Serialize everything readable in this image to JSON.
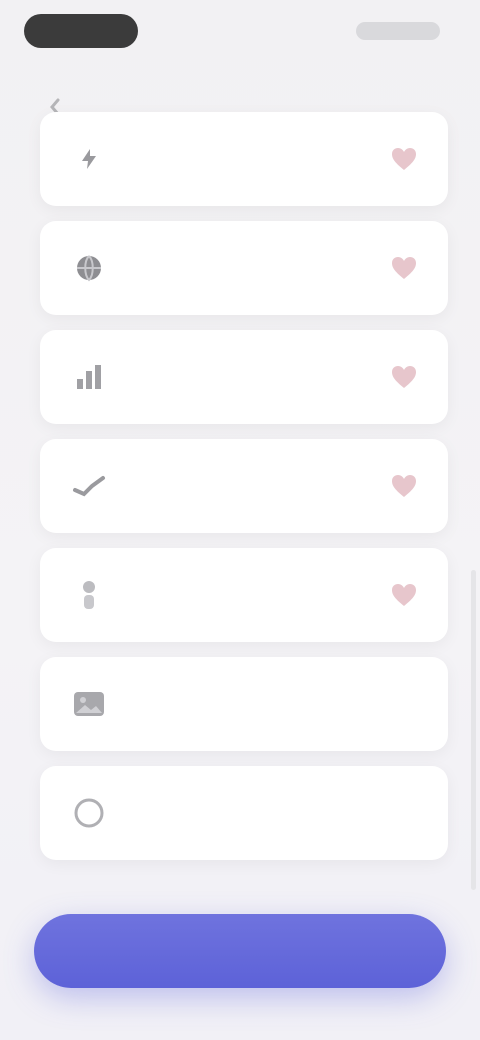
{
  "status_bar": {
    "left_pill": "",
    "right": ""
  },
  "header": {
    "title": "",
    "back_icon": "chevron-left-icon"
  },
  "items": [
    {
      "label": "",
      "icon": "bolt-icon",
      "favorite": true
    },
    {
      "label": "",
      "icon": "globe-icon",
      "favorite": true
    },
    {
      "label": "",
      "icon": "chart-icon",
      "favorite": true
    },
    {
      "label": "",
      "icon": "trend-icon",
      "favorite": true
    },
    {
      "label": "",
      "icon": "user-icon",
      "favorite": true
    },
    {
      "label": "",
      "icon": "image-icon",
      "favorite": false
    },
    {
      "label": "",
      "icon": "circle-icon",
      "favorite": false
    }
  ],
  "primary_button": {
    "label": ""
  },
  "colors": {
    "accent": "#6369DB",
    "heart": "#E7C6CC",
    "background": "#F2F1F3"
  }
}
